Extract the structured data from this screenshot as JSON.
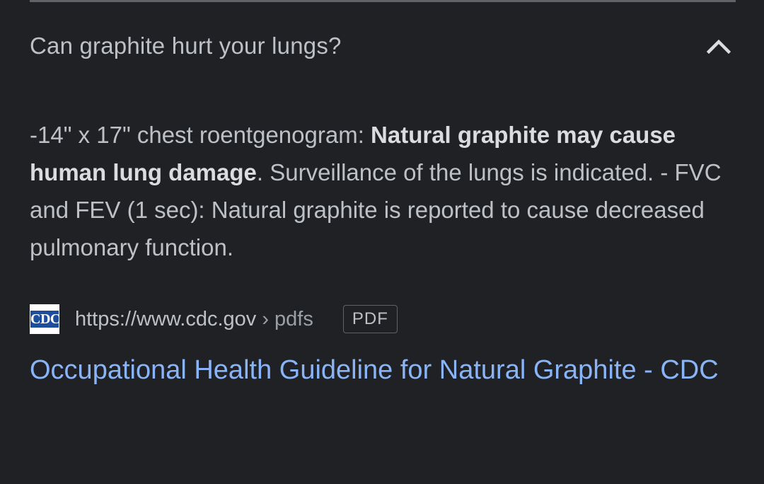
{
  "question": {
    "text": "Can graphite hurt your lungs?",
    "toggle_icon": "chevron-up-icon",
    "expanded": true
  },
  "answer": {
    "part1": "-14\" x 17\" chest roentgenogram: ",
    "bold": "Natural graphite may cause human lung damage",
    "part2": ". Surveillance of the lungs is indicated. - FVC and FEV (1 sec): Natural graphite is reported to cause decreased pulmonary function."
  },
  "source": {
    "favicon_text": "CDC",
    "url": "https://www.cdc.gov",
    "breadcrumb": " › pdfs",
    "badge": "PDF"
  },
  "result": {
    "title": "Occupational Health Guideline for Natural Graphite - CDC"
  },
  "colors": {
    "background": "#202124",
    "text": "#bdc1c6",
    "link": "#8ab4f8",
    "divider": "#5f6368"
  }
}
